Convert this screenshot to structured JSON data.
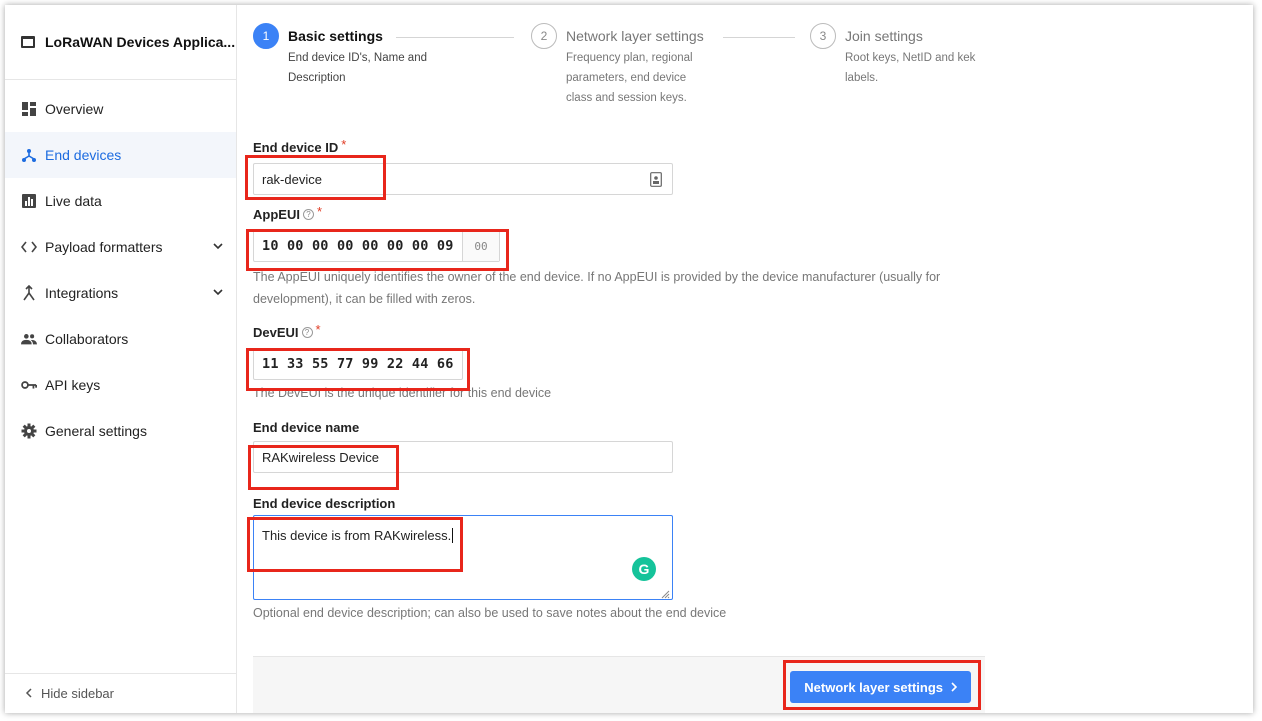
{
  "app": {
    "title": "LoRaWAN Devices Applica..."
  },
  "sidebar": {
    "items": [
      {
        "label": "Overview",
        "icon": "dashboard-icon"
      },
      {
        "label": "End devices",
        "icon": "devices-icon",
        "active": true
      },
      {
        "label": "Live data",
        "icon": "chart-icon"
      },
      {
        "label": "Payload formatters",
        "icon": "code-icon",
        "expandable": true
      },
      {
        "label": "Integrations",
        "icon": "merge-icon",
        "expandable": true
      },
      {
        "label": "Collaborators",
        "icon": "people-icon"
      },
      {
        "label": "API keys",
        "icon": "key-icon"
      },
      {
        "label": "General settings",
        "icon": "gear-icon"
      }
    ],
    "hide_label": "Hide sidebar"
  },
  "steps": [
    {
      "number": "1",
      "title": "Basic settings",
      "description": "End device ID's, Name and Description"
    },
    {
      "number": "2",
      "title": "Network layer settings",
      "description": "Frequency plan, regional parameters, end device class and session keys."
    },
    {
      "number": "3",
      "title": "Join settings",
      "description": "Root keys, NetID and kek labels."
    }
  ],
  "form": {
    "device_id": {
      "label": "End device ID",
      "value": "rak-device"
    },
    "app_eui": {
      "label": "AppEUI",
      "value": "10 00 00 00 00 00 00 09",
      "suffix": "00",
      "hint": "The AppEUI uniquely identifies the owner of the end device. If no AppEUI is provided by the device manufacturer (usually for development), it can be filled with zeros."
    },
    "dev_eui": {
      "label": "DevEUI",
      "value": "11 33 55 77 99 22 44 66",
      "hint": "The DevEUI is the unique identifier for this end device"
    },
    "device_name": {
      "label": "End device name",
      "value": "RAKwireless Device"
    },
    "device_description": {
      "label": "End device description",
      "value": "This device is from RAKwireless.",
      "hint": "Optional end device description; can also be used to save notes about the end device"
    },
    "required_mark": "*",
    "help_mark": "?"
  },
  "footer": {
    "next_label": "Network layer settings"
  },
  "colors": {
    "accent": "#3b82f6",
    "highlight": "#e8261b",
    "grammarly": "#15c39a"
  }
}
